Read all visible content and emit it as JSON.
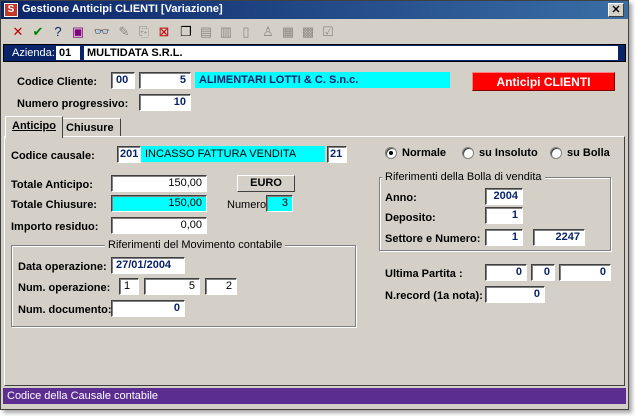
{
  "window": {
    "title": "Gestione Anticipi CLIENTI [Variazione]",
    "app_icon_letter": "S",
    "close_symbol": "✕"
  },
  "toolbar": [
    {
      "name": "delete-icon",
      "glyph": "✕",
      "color": "#c00000",
      "enabled": true
    },
    {
      "name": "confirm-icon",
      "glyph": "✔",
      "color": "#008000",
      "enabled": true
    },
    {
      "name": "help-icon",
      "glyph": "?",
      "color": "#0a246a",
      "enabled": true
    },
    {
      "name": "book-icon",
      "glyph": "▣",
      "color": "#800080",
      "enabled": true
    },
    {
      "name": "binoculars-icon",
      "glyph": "👓",
      "color": "#000000",
      "enabled": true
    },
    {
      "name": "edit-icon",
      "glyph": "✎",
      "color": "#8d8a84",
      "enabled": false
    },
    {
      "name": "copy-record-icon",
      "glyph": "⎘",
      "color": "#8d8a84",
      "enabled": false
    },
    {
      "name": "cancel-record-icon",
      "glyph": "⊠",
      "color": "#c00000",
      "enabled": true
    },
    {
      "name": "copy-icon",
      "glyph": "❐",
      "color": "#000000",
      "enabled": true
    },
    {
      "name": "paste-icon",
      "glyph": "▤",
      "color": "#8d8a84",
      "enabled": false
    },
    {
      "name": "clipboard-icon",
      "glyph": "▥",
      "color": "#8d8a84",
      "enabled": false
    },
    {
      "name": "document-icon",
      "glyph": "▯",
      "color": "#8d8a84",
      "enabled": false
    },
    {
      "name": "user-icon",
      "glyph": "♙",
      "color": "#8d8a84",
      "enabled": false
    },
    {
      "name": "report-icon",
      "glyph": "▦",
      "color": "#8d8a84",
      "enabled": false
    },
    {
      "name": "form-icon",
      "glyph": "▩",
      "color": "#8d8a84",
      "enabled": false
    },
    {
      "name": "checklist-icon",
      "glyph": "☑",
      "color": "#8d8a84",
      "enabled": false
    }
  ],
  "azienda": {
    "label": "Azienda:",
    "code": "01",
    "name": "MULTIDATA S.R.L."
  },
  "header": {
    "codice_cliente_label": "Codice Cliente:",
    "cliente_code1": "00",
    "cliente_code2": "5",
    "cliente_name": "ALIMENTARI LOTTI & C. S.n.c.",
    "numero_progressivo_label": "Numero progressivo:",
    "numero_progressivo": "10",
    "anticipi_button": "Anticipi CLIENTI"
  },
  "tabs": [
    {
      "label": "Anticipo",
      "active": true
    },
    {
      "label": "Chiusure",
      "active": false
    }
  ],
  "anticipo": {
    "codice_causale_label": "Codice causale:",
    "causale_code": "201",
    "causale_desc": "INCASSO FATTURA VENDITA",
    "causale_extra": "21",
    "totale_anticipo_label": "Totale Anticipo:",
    "totale_anticipo": "150,00",
    "totale_chiusure_label": "Totale Chiusure:",
    "totale_chiusure": "150,00",
    "importo_residuo_label": "Importo residuo:",
    "importo_residuo": "0,00",
    "currency": "EURO",
    "numero_label": "Numero:",
    "numero": "3",
    "movimento_group_title": "Riferimenti del Movimento contabile",
    "data_operazione_label": "Data operazione:",
    "data_operazione": "27/01/2004",
    "num_operazione_label": "Num. operazione:",
    "num_op_1": "1",
    "num_op_2": "5",
    "num_op_3": "2",
    "num_documento_label": "Num. documento:",
    "num_documento": "0"
  },
  "radio": [
    {
      "label": "Normale",
      "checked": true
    },
    {
      "label": "su Insoluto",
      "checked": false
    },
    {
      "label": "su Bolla",
      "checked": false
    }
  ],
  "bolla": {
    "group_title": "Riferimenti della Bolla di vendita",
    "anno_label": "Anno:",
    "anno": "2004",
    "deposito_label": "Deposito:",
    "deposito": "1",
    "settore_label": "Settore e Numero:",
    "settore": "1",
    "numero": "2247"
  },
  "partita": {
    "ultima_label": "Ultima Partita :",
    "p1": "0",
    "p2": "0",
    "p3": "0",
    "nrecord_label": "N.record (1a nota):",
    "nrecord": "0"
  },
  "statusbar": {
    "text": "Codice della Causale contabile"
  },
  "colors": {
    "title_bar": "#0a246a",
    "status_bar": "#5c2d91",
    "cyan_highlight": "#00ffff",
    "anticipi_button": "#ff0000"
  }
}
